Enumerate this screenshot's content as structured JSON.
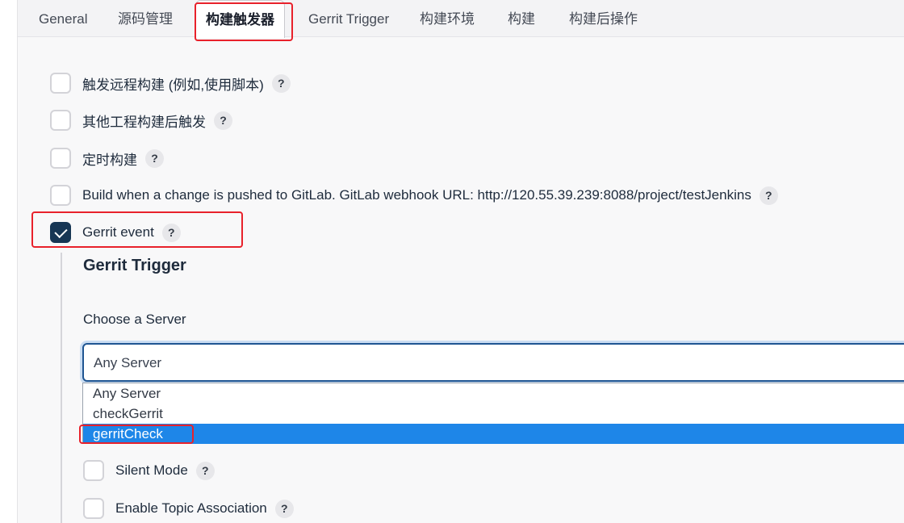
{
  "tabs": [
    {
      "label": "General"
    },
    {
      "label": "源码管理"
    },
    {
      "label": "构建触发器"
    },
    {
      "label": "Gerrit Trigger"
    },
    {
      "label": "构建环境"
    },
    {
      "label": "构建"
    },
    {
      "label": "构建后操作"
    }
  ],
  "triggers": [
    {
      "label": "触发远程构建 (例如,使用脚本)",
      "checked": false
    },
    {
      "label": "其他工程构建后触发",
      "checked": false
    },
    {
      "label": "定时构建",
      "checked": false
    },
    {
      "label": "Build when a change is pushed to GitLab. GitLab webhook URL: http://120.55.39.239:8088/project/testJenkins",
      "checked": false
    },
    {
      "label": "Gerrit event",
      "checked": true
    }
  ],
  "help_glyph": "?",
  "gerrit": {
    "section_title": "Gerrit Trigger",
    "server_label": "Choose a Server",
    "server_value": "Any Server",
    "server_options": [
      "Any Server",
      "checkGerrit",
      "gerritCheck"
    ],
    "highlighted_option": "gerritCheck",
    "silent_mode_label": "Silent Mode",
    "topic_label": "Enable Topic Association"
  },
  "colors": {
    "checkbox_checked": "#173654",
    "highlight_annotation": "#e8212b",
    "option_selected": "#1e86e8"
  }
}
